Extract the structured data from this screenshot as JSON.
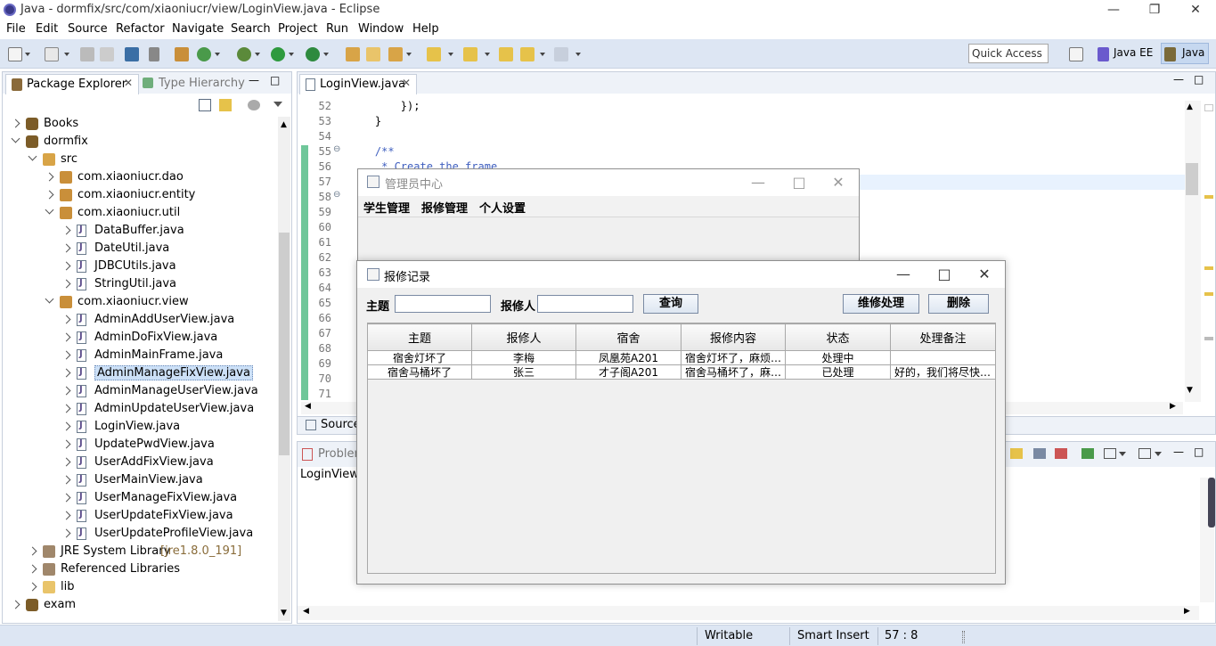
{
  "window": {
    "title": "Java - dormfix/src/com/xiaoniucr/view/LoginView.java - Eclipse"
  },
  "menu": [
    "File",
    "Edit",
    "Source",
    "Refactor",
    "Navigate",
    "Search",
    "Project",
    "Run",
    "Window",
    "Help"
  ],
  "toolbar": {
    "quick_access_placeholder": "Quick Access",
    "perspectives": [
      "Java EE",
      "Java"
    ],
    "active_perspective": "Java"
  },
  "package_explorer": {
    "tabs": [
      "Package Explorer",
      "Type Hierarchy"
    ],
    "tree": [
      {
        "label": "Books",
        "extra": "",
        "depth": 0,
        "expand": "right",
        "icon": "project-icon"
      },
      {
        "label": "dormfix",
        "extra": "",
        "depth": 0,
        "expand": "down",
        "icon": "project-icon"
      },
      {
        "label": "src",
        "extra": "",
        "depth": 1,
        "expand": "down",
        "icon": "source-folder-icon"
      },
      {
        "label": "com.xiaoniucr.dao",
        "extra": "",
        "depth": 2,
        "expand": "right",
        "icon": "package-icon"
      },
      {
        "label": "com.xiaoniucr.entity",
        "extra": "",
        "depth": 2,
        "expand": "right",
        "icon": "package-icon"
      },
      {
        "label": "com.xiaoniucr.util",
        "extra": "",
        "depth": 2,
        "expand": "down",
        "icon": "package-icon"
      },
      {
        "label": "DataBuffer.java",
        "extra": "",
        "depth": 3,
        "expand": "right",
        "icon": "java-file-icon"
      },
      {
        "label": "DateUtil.java",
        "extra": "",
        "depth": 3,
        "expand": "right",
        "icon": "java-file-icon"
      },
      {
        "label": "JDBCUtils.java",
        "extra": "",
        "depth": 3,
        "expand": "right",
        "icon": "java-file-icon"
      },
      {
        "label": "StringUtil.java",
        "extra": "",
        "depth": 3,
        "expand": "right",
        "icon": "java-file-icon"
      },
      {
        "label": "com.xiaoniucr.view",
        "extra": "",
        "depth": 2,
        "expand": "down",
        "icon": "package-icon"
      },
      {
        "label": "AdminAddUserView.java",
        "extra": "",
        "depth": 3,
        "expand": "right",
        "icon": "java-file-icon"
      },
      {
        "label": "AdminDoFixView.java",
        "extra": "",
        "depth": 3,
        "expand": "right",
        "icon": "java-file-icon"
      },
      {
        "label": "AdminMainFrame.java",
        "extra": "",
        "depth": 3,
        "expand": "right",
        "icon": "java-file-icon"
      },
      {
        "label": "AdminManageFixView.java",
        "extra": "",
        "depth": 3,
        "expand": "right",
        "icon": "java-file-icon",
        "selected": true
      },
      {
        "label": "AdminManageUserView.java",
        "extra": "",
        "depth": 3,
        "expand": "right",
        "icon": "java-file-icon"
      },
      {
        "label": "AdminUpdateUserView.java",
        "extra": "",
        "depth": 3,
        "expand": "right",
        "icon": "java-file-icon"
      },
      {
        "label": "LoginView.java",
        "extra": "",
        "depth": 3,
        "expand": "right",
        "icon": "java-file-icon"
      },
      {
        "label": "UpdatePwdView.java",
        "extra": "",
        "depth": 3,
        "expand": "right",
        "icon": "java-file-icon"
      },
      {
        "label": "UserAddFixView.java",
        "extra": "",
        "depth": 3,
        "expand": "right",
        "icon": "java-file-icon"
      },
      {
        "label": "UserMainView.java",
        "extra": "",
        "depth": 3,
        "expand": "right",
        "icon": "java-file-icon"
      },
      {
        "label": "UserManageFixView.java",
        "extra": "",
        "depth": 3,
        "expand": "right",
        "icon": "java-file-icon"
      },
      {
        "label": "UserUpdateFixView.java",
        "extra": "",
        "depth": 3,
        "expand": "right",
        "icon": "java-file-icon"
      },
      {
        "label": "UserUpdateProfileView.java",
        "extra": "",
        "depth": 3,
        "expand": "right",
        "icon": "java-file-icon"
      },
      {
        "label": "JRE System Library",
        "extra": "[jre1.8.0_191]",
        "depth": 1,
        "expand": "right",
        "icon": "library-icon"
      },
      {
        "label": "Referenced Libraries",
        "extra": "",
        "depth": 1,
        "expand": "right",
        "icon": "library-icon"
      },
      {
        "label": "lib",
        "extra": "",
        "depth": 1,
        "expand": "right",
        "icon": "folder-icon"
      },
      {
        "label": "exam",
        "extra": "",
        "depth": 0,
        "expand": "right",
        "icon": "project-icon"
      }
    ]
  },
  "editor": {
    "tab": "LoginView.java",
    "lines": [
      {
        "n": "52",
        "code": "        });"
      },
      {
        "n": "53",
        "code": "    }"
      },
      {
        "n": "54",
        "code": ""
      },
      {
        "n": "55",
        "code": "    /**"
      },
      {
        "n": "56",
        "code": "     * Create the frame."
      },
      {
        "n": "57",
        "code": ""
      },
      {
        "n": "58",
        "code": ""
      },
      {
        "n": "59",
        "code": ""
      },
      {
        "n": "60",
        "code": ""
      },
      {
        "n": "61",
        "code": ""
      },
      {
        "n": "62",
        "code": ""
      },
      {
        "n": "63",
        "code": ""
      },
      {
        "n": "64",
        "code": ""
      },
      {
        "n": "65",
        "code": ""
      },
      {
        "n": "66",
        "code": ""
      },
      {
        "n": "67",
        "code": ""
      },
      {
        "n": "68",
        "code": ""
      },
      {
        "n": "69",
        "code": ""
      },
      {
        "n": "70",
        "code": ""
      },
      {
        "n": "71",
        "code": ""
      }
    ],
    "bottom_tab": "Source"
  },
  "problems_view": {
    "tab": "Problem",
    "breadcrumb": "LoginView"
  },
  "admin_window": {
    "title": "管理员中心",
    "menu": [
      "学生管理",
      "报修管理",
      "个人设置"
    ]
  },
  "repair_window": {
    "title": "报修记录",
    "subject_label": "主题",
    "subject_value": "",
    "reporter_label": "报修人",
    "reporter_value": "",
    "query_button": "查询",
    "repair_button": "维修处理",
    "delete_button": "删除",
    "columns": [
      "主题",
      "报修人",
      "宿舍",
      "报修内容",
      "状态",
      "处理备注"
    ],
    "rows": [
      [
        "宿舍灯坏了",
        "李梅",
        "凤凰苑A201",
        "宿舍灯坏了，麻烦…",
        "处理中",
        ""
      ],
      [
        "宿舍马桶坏了",
        "张三",
        "才子阁A201",
        "宿舍马桶坏了，麻…",
        "已处理",
        "好的，我们将尽快…"
      ]
    ]
  },
  "statusbar": {
    "writable": "Writable",
    "insert_mode": "Smart Insert",
    "position": "57 : 8"
  },
  "colors": {
    "toolbar_bg": "#dde6f3",
    "selection": "#cce0f7",
    "comment": "#3f5fbf"
  }
}
